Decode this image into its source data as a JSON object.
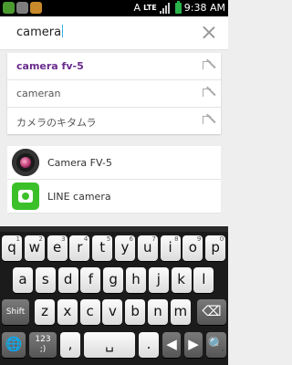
{
  "status_bar": {
    "time": "9:38 AM",
    "network": "LTE",
    "icons": [
      "notification-icon",
      "image-icon",
      "camera-app-icon",
      "signal-icon",
      "battery-icon"
    ]
  },
  "search": {
    "query": "camera"
  },
  "suggestions": [
    {
      "text": "camera fv-5"
    },
    {
      "text": "cameran"
    },
    {
      "text": "カメラのキタムラ"
    }
  ],
  "results": [
    {
      "name": "Camera FV-5",
      "icon": "camera-fv5-app-icon"
    },
    {
      "name": "LINE camera",
      "icon": "line-camera-app-icon"
    }
  ],
  "keyboard": {
    "row1": [
      {
        "k": "q",
        "s": "1"
      },
      {
        "k": "w",
        "s": "2"
      },
      {
        "k": "e",
        "s": "3"
      },
      {
        "k": "r",
        "s": "4"
      },
      {
        "k": "t",
        "s": "5"
      },
      {
        "k": "y",
        "s": "6"
      },
      {
        "k": "u",
        "s": "7"
      },
      {
        "k": "i",
        "s": "8"
      },
      {
        "k": "o",
        "s": "9"
      },
      {
        "k": "p",
        "s": "0"
      }
    ],
    "row2": [
      {
        "k": "a",
        "s": ""
      },
      {
        "k": "s",
        "s": ""
      },
      {
        "k": "d",
        "s": ""
      },
      {
        "k": "f",
        "s": ""
      },
      {
        "k": "g",
        "s": ""
      },
      {
        "k": "h",
        "s": ""
      },
      {
        "k": "j",
        "s": ""
      },
      {
        "k": "k",
        "s": ""
      },
      {
        "k": "l",
        "s": ""
      }
    ],
    "row3": [
      {
        "k": "z",
        "s": ""
      },
      {
        "k": "x",
        "s": ""
      },
      {
        "k": "c",
        "s": ""
      },
      {
        "k": "v",
        "s": ""
      },
      {
        "k": "b",
        "s": ""
      },
      {
        "k": "n",
        "s": ""
      },
      {
        "k": "m",
        "s": ""
      }
    ],
    "shift_label": "Shift",
    "symbols_label": "123\n;)",
    "comma_label": ",",
    "period_label": ".",
    "colors": {
      "board": "#1b1b1b",
      "key": "#f0f0f0",
      "accent": "#33b5e5"
    }
  }
}
